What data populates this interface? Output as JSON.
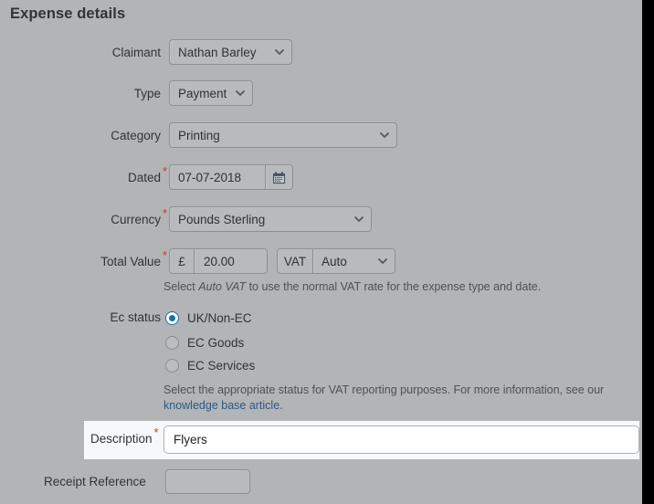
{
  "page": {
    "title": "Expense details",
    "background_color": "#b3b4b6",
    "accent_color": "#1273ab",
    "required_marker": "*",
    "link_color": "#2a5a87"
  },
  "fields": {
    "claimant": {
      "label": "Claimant",
      "value": "Nathan Barley",
      "control": "select",
      "icon": "chevron-down-icon"
    },
    "type": {
      "label": "Type",
      "value": "Payment",
      "control": "select",
      "icon": "chevron-down-icon"
    },
    "category": {
      "label": "Category",
      "value": "Printing",
      "control": "select",
      "icon": "chevron-down-icon"
    },
    "dated": {
      "label": "Dated",
      "value": "07-07-2018",
      "required": true,
      "control": "text",
      "button_icon": "calendar-icon"
    },
    "currency": {
      "label": "Currency",
      "value": "Pounds Sterling",
      "required": true,
      "control": "select",
      "icon": "chevron-down-icon"
    },
    "total_value": {
      "label": "Total Value",
      "required": true,
      "currency_symbol": "£",
      "amount": "20.00",
      "vat_label": "VAT",
      "vat_value": "Auto",
      "vat_icon": "chevron-down-icon",
      "help_prefix": "Select ",
      "help_emphasis": "Auto VAT",
      "help_suffix": " to use the normal VAT rate for the expense type and date."
    },
    "ec_status": {
      "label": "Ec status",
      "options": [
        {
          "label": "UK/Non-EC",
          "selected": true
        },
        {
          "label": "EC Goods",
          "selected": false
        },
        {
          "label": "EC Services",
          "selected": false
        }
      ],
      "help_text": "Select the appropriate status for VAT reporting purposes. For more information, see our ",
      "help_link": "knowledge base article",
      "help_suffix": "."
    },
    "description": {
      "label": "Description",
      "required": true,
      "value": "Flyers",
      "placeholder": "",
      "highlighted": true
    },
    "receipt_reference": {
      "label": "Receipt Reference",
      "value": "",
      "placeholder": ""
    }
  }
}
